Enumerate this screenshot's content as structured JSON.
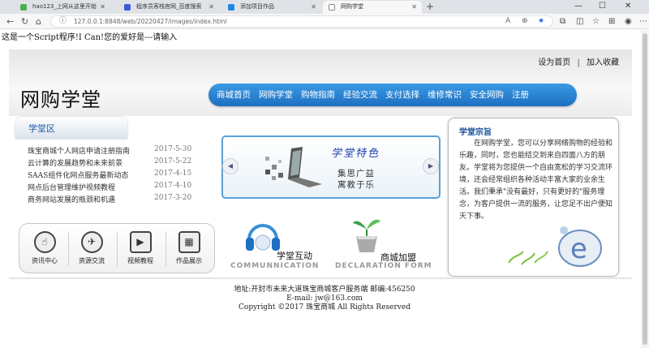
{
  "browser": {
    "tabs": [
      {
        "title": "hao123_上网从这里开始",
        "active": false,
        "color": "#4caf50"
      },
      {
        "title": "程序员客栈官网_百度搜索",
        "active": false,
        "color": "#3b5bdb"
      },
      {
        "title": "添加项目作品",
        "active": false,
        "color": "#1e88e5"
      },
      {
        "title": "网购学堂",
        "active": true,
        "color": "#ffffff"
      }
    ],
    "url": "127.0.0.1:8848/web/20220427/images/index.html"
  },
  "script_output": "这是一个Script程序!I Can!您的爱好是---请输入",
  "header": {
    "links": [
      "设为首页",
      "加入收藏"
    ],
    "logo": "网购学堂",
    "nav": [
      "商城首页",
      "网购学堂",
      "购物指南",
      "经验交流",
      "支付选择",
      "维修常识",
      "安全网购",
      "注册"
    ]
  },
  "left": {
    "tab_title": "学堂区",
    "news": [
      {
        "title": "珠宝商城个人网店申请注册指南",
        "date": "2017-5-30"
      },
      {
        "title": "云计算的发展趋势和未来前景",
        "date": "2017-5-22"
      },
      {
        "title": "SAAS组件化网点服务最新动态",
        "date": "2017-4-15"
      },
      {
        "title": "网点后台管理维护视频教程",
        "date": "2017-4-10"
      },
      {
        "title": "商务网站发展的瓶颈和机遇",
        "date": "2017-3-20"
      }
    ],
    "icons": [
      {
        "label": "资讯中心",
        "icon": "touch-icon"
      },
      {
        "label": "资源交流",
        "icon": "globe-icon"
      },
      {
        "label": "视频教程",
        "icon": "video-icon"
      },
      {
        "label": "作品展示",
        "icon": "gallery-icon"
      }
    ]
  },
  "banner": {
    "title": "学堂特色",
    "line1": "集思广益",
    "line2": "寓教于乐"
  },
  "promos": [
    {
      "cn": "学堂互动",
      "en": "COMMUNNICATION"
    },
    {
      "cn": "商城加盟",
      "en": "DECLARATION FORM"
    }
  ],
  "right": {
    "title": "学堂宗旨",
    "text": "在网购学堂，您可以分享网络购物的经验和乐趣，同时，您也能结交到来自四面八方的朋友。学堂将为您提供一个自由宽松的学习交流环境，还会经常组织各种活动丰富大家的业余生活。我们秉承\"没有最好，只有更好的\"服务理念，为客户提供一流的服务，让您足不出户便知天下事。"
  },
  "footer": {
    "address": "地址:开封市未来大道珠宝商城客户服务端 邮编:456250",
    "email": "E-mail: jw@163.com",
    "copyright": "Copyright ©2017 珠宝商城 All Rights Reserved"
  }
}
